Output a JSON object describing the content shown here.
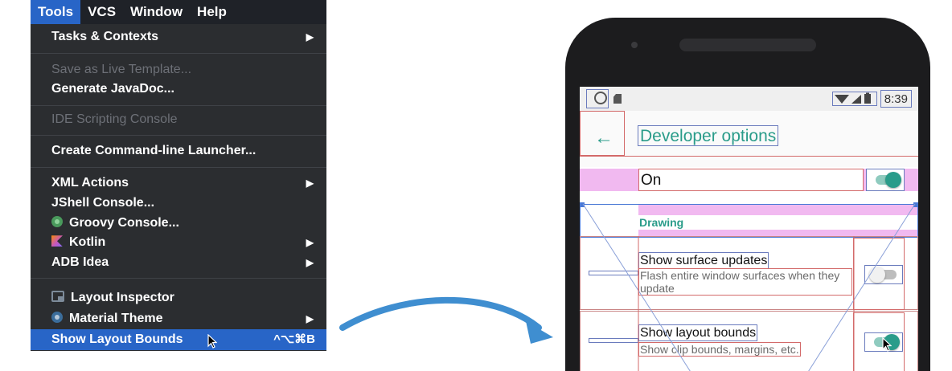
{
  "menubar": {
    "items": [
      {
        "label": "Tools",
        "active": true
      },
      {
        "label": "VCS",
        "active": false
      },
      {
        "label": "Window",
        "active": false
      },
      {
        "label": "Help",
        "active": false
      }
    ]
  },
  "menu": {
    "tasks_contexts": "Tasks & Contexts",
    "save_live_template": "Save as Live Template...",
    "generate_javadoc": "Generate JavaDoc...",
    "ide_scripting_console": "IDE Scripting Console",
    "create_launcher": "Create Command-line Launcher...",
    "xml_actions": "XML Actions",
    "jshell_console": "JShell Console...",
    "groovy_console": "Groovy Console...",
    "kotlin": "Kotlin",
    "adb_idea": "ADB Idea",
    "layout_inspector": "Layout Inspector",
    "material_theme": "Material Theme",
    "show_layout_bounds": "Show Layout Bounds",
    "show_layout_bounds_shortcut": "^⌥⌘B",
    "submenu_arrow": "▶"
  },
  "phone": {
    "status_time": "8:39",
    "title": "Developer options",
    "back_arrow": "←",
    "master_switch_label": "On",
    "section_header": "Drawing",
    "prefs": [
      {
        "title": "Show surface updates",
        "summary": "Flash entire window surfaces when they update",
        "enabled": false
      },
      {
        "title": "Show layout bounds",
        "summary": "Show clip bounds, margins, etc.",
        "enabled": true
      }
    ]
  },
  "colors": {
    "menu_bg": "#2b2d30",
    "menu_selected": "#2865c7",
    "accent_teal": "#2a9c8a",
    "bounds_red": "#d36a6a",
    "bounds_blue": "#6a7bbd",
    "margin_pink": "#f1b9f0",
    "arrow_blue": "#3f8ed0"
  },
  "icons": [
    "groovy-icon",
    "kotlin-icon",
    "layout-inspector-icon",
    "material-theme-icon",
    "back-arrow-icon",
    "wifi-icon",
    "cellular-icon",
    "battery-icon",
    "curved-arrow-icon",
    "mouse-cursor-icon"
  ]
}
